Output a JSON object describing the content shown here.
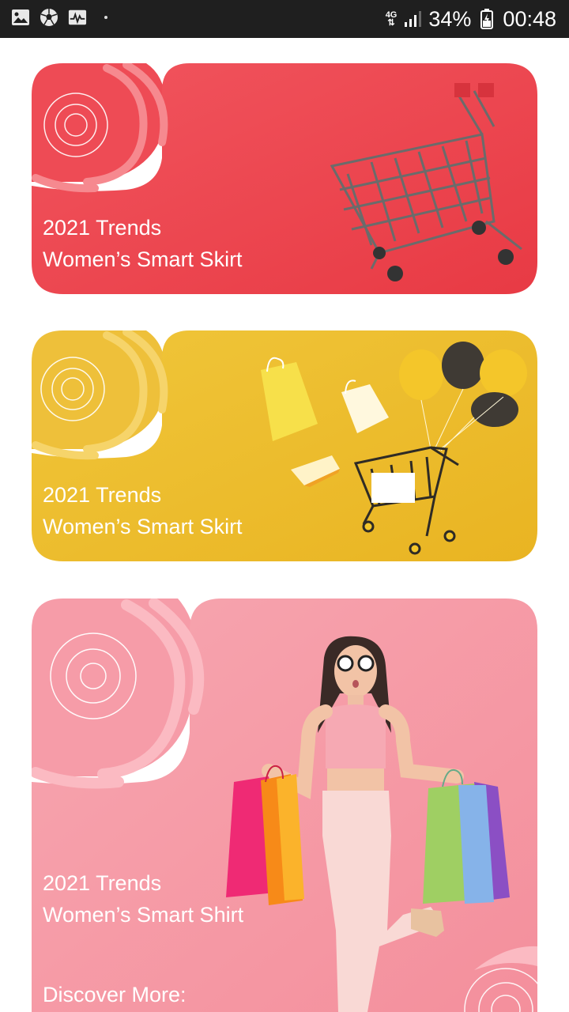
{
  "status_bar": {
    "network": "4G",
    "battery": "34%",
    "time": "00:48",
    "icons": [
      "image-icon",
      "soccer-ball-icon",
      "activity-monitor-icon",
      "signal-icon",
      "battery-icon"
    ]
  },
  "cards": [
    {
      "line1": "2021 Trends",
      "line2": "Women’s Smart Skirt",
      "color": "#ee4450",
      "image": "shopping-cart"
    },
    {
      "line1": "2021 Trends",
      "line2": "Women’s Smart Skirt",
      "color": "#eebb2a",
      "image": "bags-balloons-cart"
    },
    {
      "line1": "2021 Trends",
      "line2": "Women’s Smart Shirt",
      "color": "#f6a0aa",
      "image": "woman-with-shopping-bags",
      "cta": "Discover More:"
    }
  ]
}
